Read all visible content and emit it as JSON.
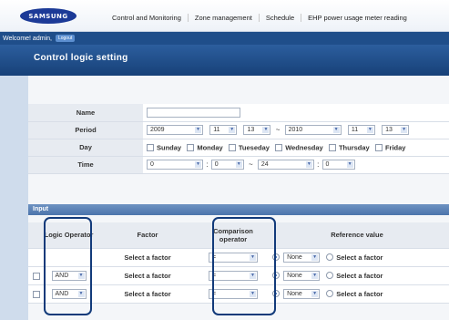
{
  "header": {
    "logo": "SAMSUNG",
    "menu": [
      "Control and Monitoring",
      "Zone management",
      "Schedule",
      "EHP power usage meter reading"
    ]
  },
  "user": {
    "welcome": "Welcome! admin,",
    "logout": "Logout"
  },
  "page_title": "Control logic setting",
  "form": {
    "name_label": "Name",
    "name_value": "",
    "period_label": "Period",
    "period": {
      "start_year": "2009",
      "start_month": "11",
      "start_day": "13",
      "end_year": "2010",
      "end_month": "11",
      "end_day": "13",
      "separator": "~"
    },
    "day_label": "Day",
    "days": [
      "Sunday",
      "Monday",
      "Tueseday",
      "Wednesday",
      "Thursday",
      "Friday"
    ],
    "time_label": "Time",
    "time": {
      "start_hour": "0",
      "start_min": "0",
      "end_hour": "24",
      "end_min": "0",
      "separator": "~",
      "colon": ":"
    }
  },
  "input": {
    "section_title": "Input",
    "headers": {
      "logic_operator": "Logic Operator",
      "factor": "Factor",
      "comparison_operator": "Comparison operator",
      "reference_value": "Reference value"
    },
    "rows": [
      {
        "logic": "",
        "factor": "Select a factor",
        "comparison": "=",
        "ref_option": "None",
        "ref_text": "Select a factor"
      },
      {
        "logic": "AND",
        "factor": "Select a factor",
        "comparison": "=",
        "ref_option": "None",
        "ref_text": "Select a factor"
      },
      {
        "logic": "AND",
        "factor": "Select a factor",
        "comparison": "=",
        "ref_option": "None",
        "ref_text": "Select a factor"
      }
    ]
  }
}
